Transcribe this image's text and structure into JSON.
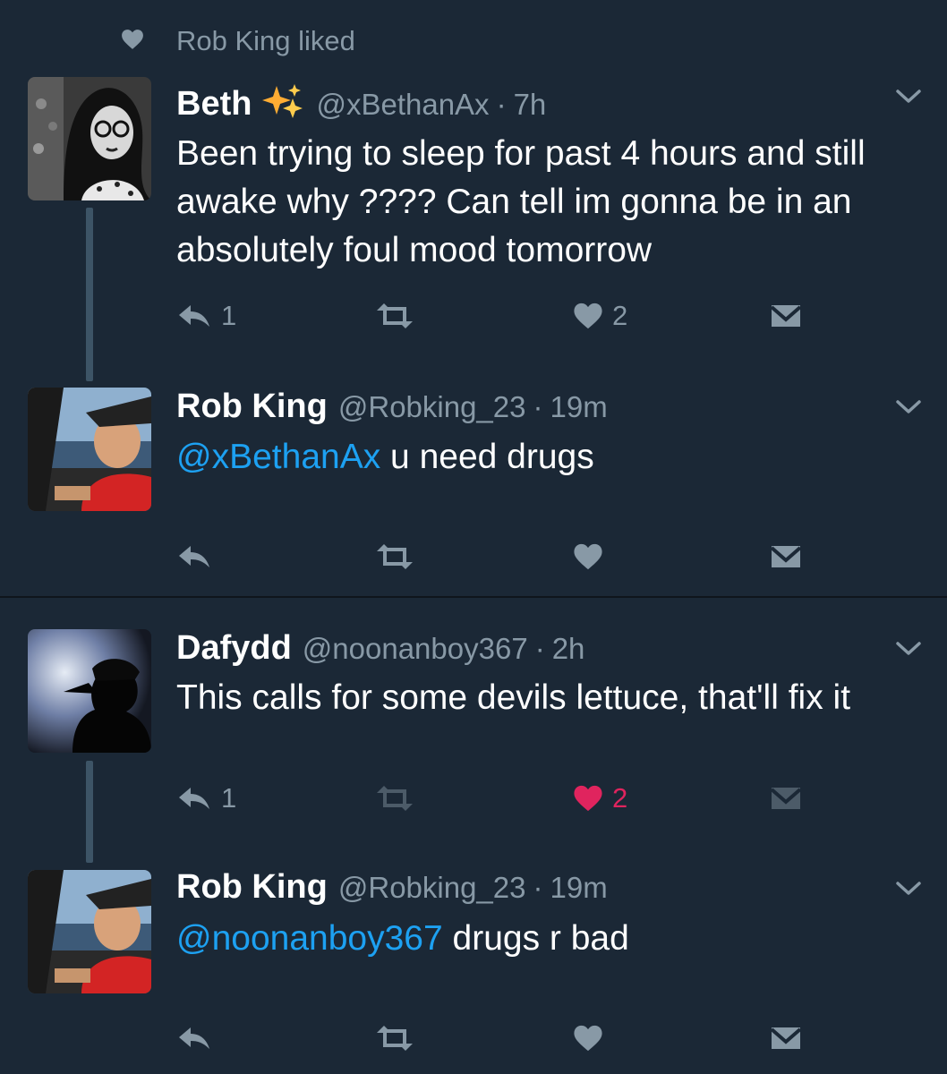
{
  "context": {
    "text": "Rob King liked"
  },
  "tweets": [
    {
      "name": "Beth",
      "handle": "@xBethanAx",
      "time": "7h",
      "text": "Been trying to sleep for past 4 hours and still awake why ???? Can tell im gonna be in an absolutely foul mood tomorrow",
      "reply_count": "1",
      "like_count": "2",
      "badge_icon": "sparkle-icon"
    },
    {
      "name": "Rob King",
      "handle": "@Robking_23",
      "time": "19m",
      "mention": "@xBethanAx",
      "text": " u need drugs"
    },
    {
      "name": "Dafydd",
      "handle": "@noonanboy367",
      "time": "2h",
      "text": "This calls for some devils lettuce, that'll fix it",
      "reply_count": "1",
      "like_count": "2"
    },
    {
      "name": "Rob King",
      "handle": "@Robking_23",
      "time": "19m",
      "mention": "@noonanboy367",
      "text": " drugs r bad"
    }
  ],
  "separator": "·",
  "colors": {
    "background": "#1b2836",
    "secondary_text": "#8899a6",
    "link": "#1da1f2",
    "liked_heart": "#e0245e",
    "thread_line": "#3d5466"
  }
}
